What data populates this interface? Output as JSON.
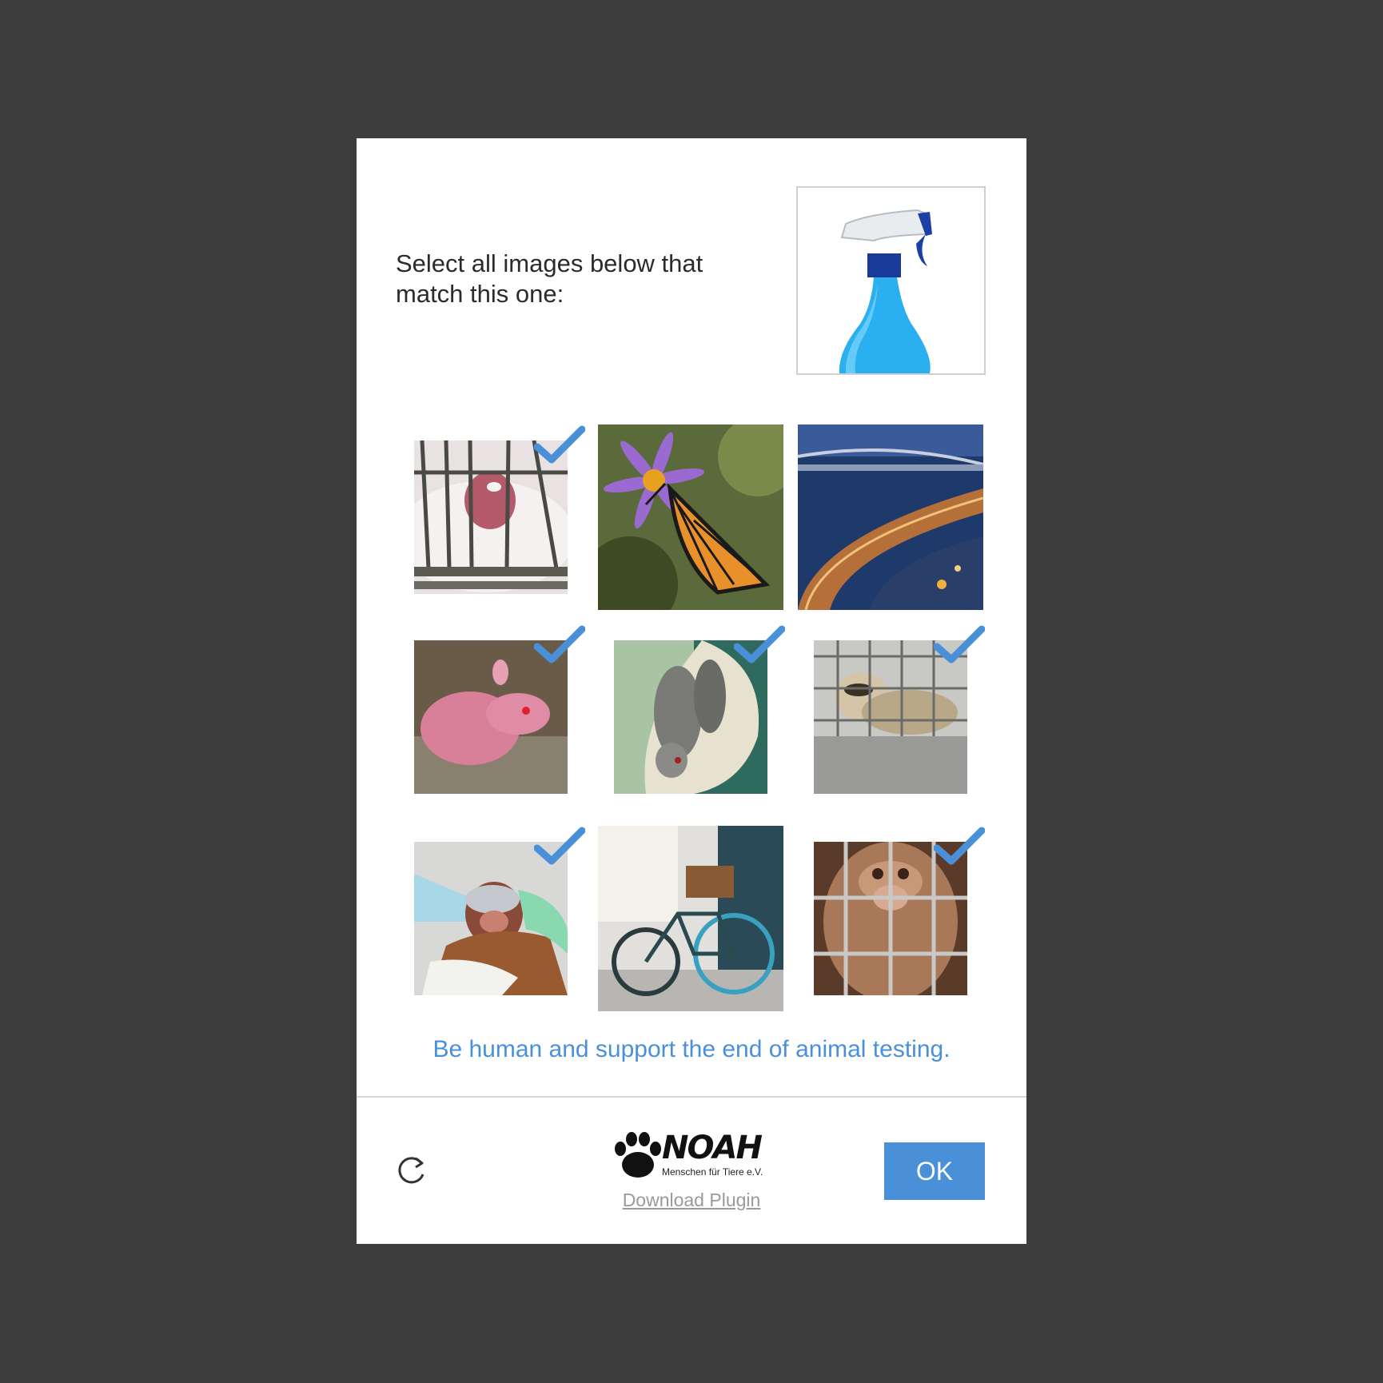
{
  "captcha": {
    "instruction": "Select all images below that match this one:",
    "reference_image": "spray-bottle",
    "tiles": [
      {
        "subject": "rabbit-in-cage",
        "selected": true
      },
      {
        "subject": "butterfly-on-flower",
        "selected": false
      },
      {
        "subject": "bridge-highway",
        "selected": false
      },
      {
        "subject": "hairless-rat",
        "selected": true
      },
      {
        "subject": "rats-in-hand",
        "selected": true
      },
      {
        "subject": "ferret-in-cage",
        "selected": true
      },
      {
        "subject": "monkey-in-lab",
        "selected": true
      },
      {
        "subject": "bicycle",
        "selected": false
      },
      {
        "subject": "monkey-in-cage",
        "selected": true
      }
    ],
    "tagline": "Be human and support the end of animal testing."
  },
  "footer": {
    "refresh_icon": "refresh-icon",
    "logo_text": "NOAH",
    "logo_subtitle": "Menschen für Tiere e.V.",
    "download_label": "Download Plugin",
    "ok_label": "OK"
  },
  "colors": {
    "accent": "#4a90d9",
    "background": "#3d3d3d",
    "dialog": "#ffffff"
  }
}
